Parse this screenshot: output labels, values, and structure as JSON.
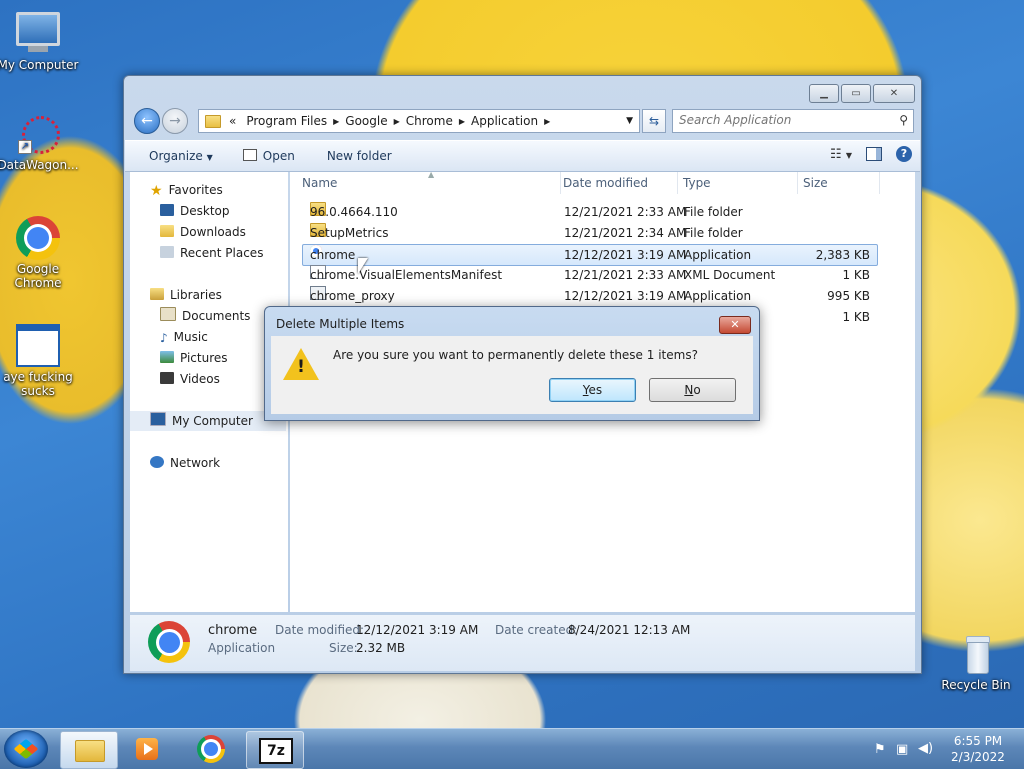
{
  "desktop": {
    "icons": [
      {
        "label": "My Computer",
        "icon": "computer-icon"
      },
      {
        "label": "DataWagon...",
        "icon": "datawagon-icon"
      },
      {
        "label": "Google Chrome",
        "icon": "chrome-icon"
      },
      {
        "label": "aye fucking sucks",
        "icon": "window-icon"
      },
      {
        "label": "Recycle Bin",
        "icon": "recycle-bin-icon"
      }
    ]
  },
  "explorer": {
    "breadcrumb": {
      "overflow": "«",
      "segments": [
        "Program Files",
        "Google",
        "Chrome",
        "Application"
      ]
    },
    "search": {
      "placeholder": "Search Application"
    },
    "toolbar": {
      "organize": "Organize",
      "open": "Open",
      "new_folder": "New folder"
    },
    "nav": {
      "favorites": "Favorites",
      "favorites_items": [
        "Desktop",
        "Downloads",
        "Recent Places"
      ],
      "libraries": "Libraries",
      "libraries_items": [
        "Documents",
        "Music",
        "Pictures",
        "Videos"
      ],
      "computer": "My Computer",
      "network": "Network"
    },
    "columns": {
      "name": "Name",
      "date": "Date modified",
      "type": "Type",
      "size": "Size"
    },
    "files": [
      {
        "name": "96.0.4664.110",
        "date": "12/21/2021 2:33 AM",
        "type": "File folder",
        "size": ""
      },
      {
        "name": "SetupMetrics",
        "date": "12/21/2021 2:34 AM",
        "type": "File folder",
        "size": ""
      },
      {
        "name": "chrome",
        "date": "12/12/2021 3:19 AM",
        "type": "Application",
        "size": "2,383 KB"
      },
      {
        "name": "chrome.VisualElementsManifest",
        "date": "12/21/2021 2:33 AM",
        "type": "XML Document",
        "size": "1 KB"
      },
      {
        "name": "chrome_proxy",
        "date": "12/12/2021 3:19 AM",
        "type": "Application",
        "size": "995 KB"
      },
      {
        "name": "",
        "date": "",
        "type": "",
        "size": "1 KB"
      }
    ],
    "details": {
      "name": "chrome",
      "type": "Application",
      "modified_label": "Date modified:",
      "modified": "12/12/2021 3:19 AM",
      "created_label": "Date created:",
      "created": "8/24/2021 12:13 AM",
      "size_label": "Size:",
      "size": "2.32 MB"
    }
  },
  "dialog": {
    "title": "Delete Multiple Items",
    "message": "Are you sure you want to permanently delete these 1 items?",
    "yes": "Yes",
    "no": "No"
  },
  "taskbar": {
    "time": "6:55 PM",
    "date": "2/3/2022",
    "sevenzip_label": "7z"
  }
}
